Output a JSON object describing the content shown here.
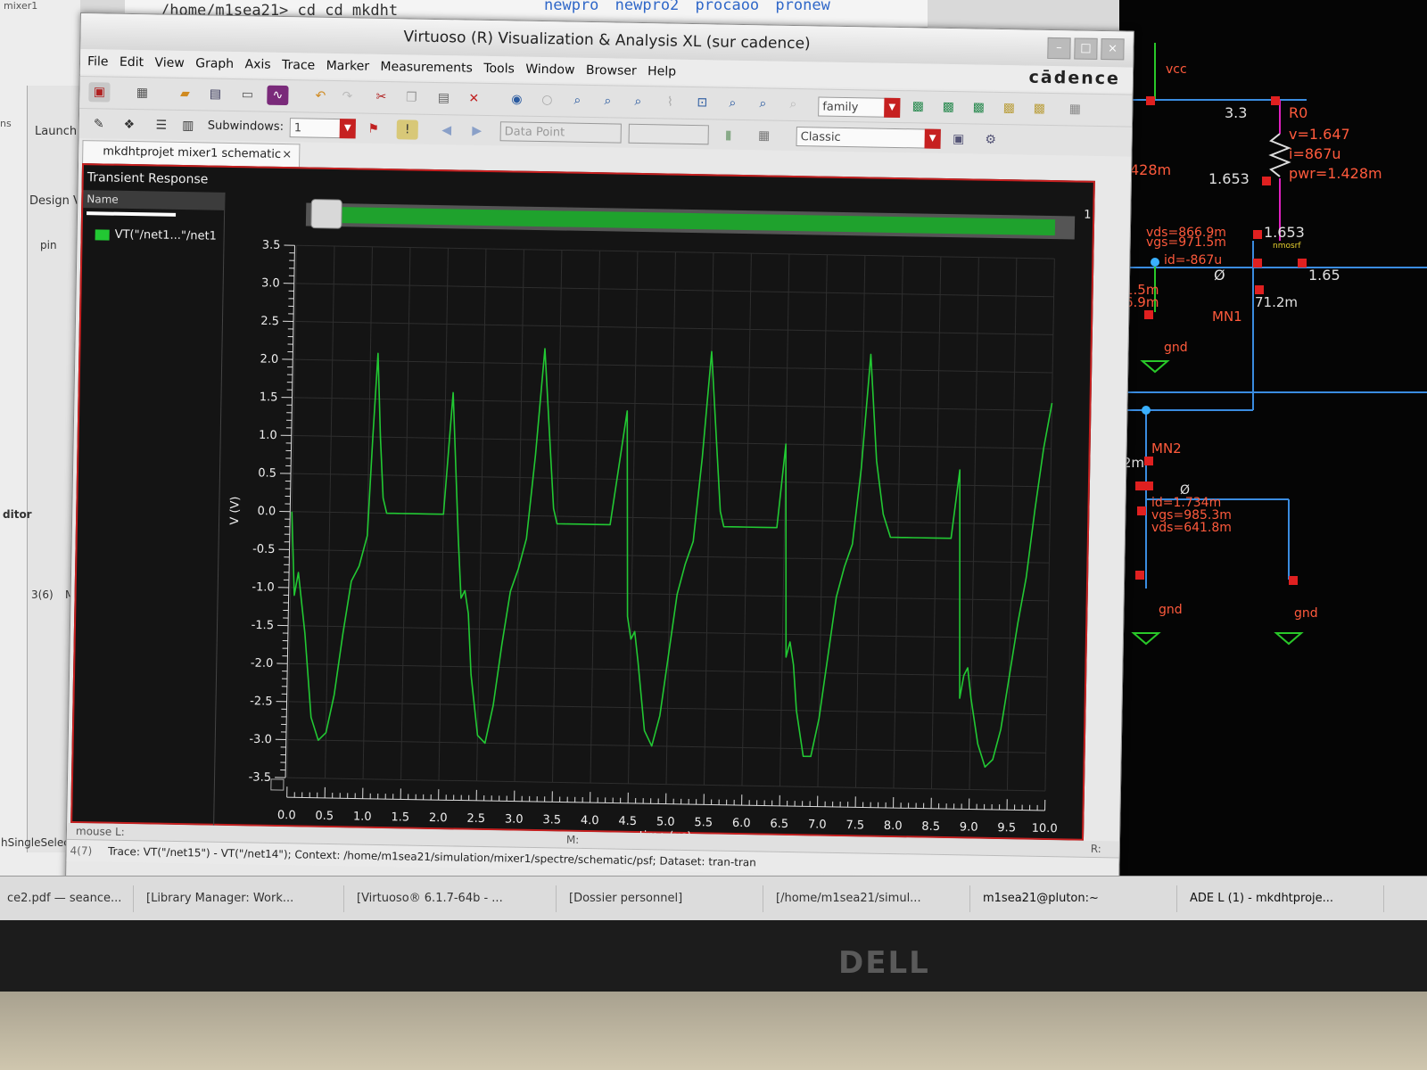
{
  "terminal": {
    "path": "/home/m1sea21> cd cd mkdht",
    "dirs": "newpro  newpro2  procaoo  pronew"
  },
  "left": {
    "mixer": "mixer1",
    "ns": "ns",
    "launch": "Launch",
    "design": "Design V",
    "pin": "pin",
    "ditor": "ditor",
    "count": "3(6)",
    "ma": "Ma",
    "single": "hSingleSelectP"
  },
  "window": {
    "title": "Virtuoso (R) Visualization & Analysis XL (sur cadence)",
    "logo": "cādence",
    "menu": [
      "File",
      "Edit",
      "View",
      "Graph",
      "Axis",
      "Trace",
      "Marker",
      "Measurements",
      "Tools",
      "Window",
      "Browser",
      "Help"
    ],
    "toolbar": {
      "family": "family",
      "subwindows_label": "Subwindows:",
      "subwindows_value": "1",
      "data_point": "Data Point",
      "classic": "Classic"
    },
    "tab": "mkdhtprojet mixer1 schematic",
    "tab_close": "×"
  },
  "graph": {
    "title": "Transient Response",
    "legend_header": "Name",
    "legend_entry": "VT(\"/net1...\"/net1",
    "subwindow_no": "1"
  },
  "chart_data": {
    "type": "line",
    "xlabel": "time (us)",
    "ylabel": "V (V)",
    "xlim": [
      0,
      10
    ],
    "ylim": [
      -3.5,
      3.5
    ],
    "xticks": [
      "0.0",
      "0.5",
      "1.0",
      "1.5",
      "2.0",
      "2.5",
      "3.0",
      "3.5",
      "4.0",
      "4.5",
      "5.0",
      "5.5",
      "6.0",
      "6.5",
      "7.0",
      "7.5",
      "8.0",
      "8.5",
      "9.0",
      "9.5",
      "10.0"
    ],
    "yticks": [
      "3.5",
      "3.0",
      "2.5",
      "2.0",
      "1.5",
      "1.0",
      "0.5",
      "0.0",
      "-0.5",
      "-1.0",
      "-1.5",
      "-2.0",
      "-2.5",
      "-3.0",
      "-3.5"
    ],
    "grid": true,
    "color": "#22c833",
    "series": [
      {
        "x": [
          0.0,
          0.05,
          0.1,
          0.2,
          0.3,
          0.4,
          0.5,
          0.6,
          0.7,
          0.8,
          0.9,
          1.0,
          1.05,
          1.1,
          1.15,
          1.2,
          1.25,
          1.3,
          1.35,
          1.4,
          1.45,
          1.5,
          1.6,
          1.8,
          2.0,
          2.1,
          2.2,
          2.25,
          2.3,
          2.35,
          2.4,
          2.5,
          2.6,
          2.7,
          2.8,
          2.9,
          3.0,
          3.1,
          3.2,
          3.3,
          3.4,
          3.45,
          3.5,
          3.55,
          3.6,
          3.7,
          3.8,
          4.0,
          4.2,
          4.4,
          4.45,
          4.5,
          4.55,
          4.6,
          4.7,
          4.8,
          4.9,
          5.0,
          5.1,
          5.2,
          5.3,
          5.4,
          5.5,
          5.6,
          5.65,
          5.7,
          5.75,
          5.8,
          5.9,
          6.0,
          6.2,
          6.4,
          6.5,
          6.55,
          6.6,
          6.65,
          6.7,
          6.8,
          6.9,
          7.0,
          7.1,
          7.2,
          7.3,
          7.4,
          7.5,
          7.6,
          7.7,
          7.8,
          7.9,
          7.95,
          8.0,
          8.05,
          8.1,
          8.2,
          8.3,
          8.5,
          8.7,
          8.8,
          8.85,
          8.9,
          8.95,
          9.0,
          9.1,
          9.2,
          9.3,
          9.4,
          9.5,
          9.6,
          9.7,
          9.8,
          9.9,
          10.0
        ],
        "y": [
          0.0,
          -1.1,
          -0.8,
          -1.6,
          -2.7,
          -3.0,
          -2.9,
          -2.4,
          -1.6,
          -0.9,
          -0.7,
          -0.3,
          1.0,
          2.1,
          1.0,
          0.2,
          0.0,
          0.0,
          0.0,
          0.0,
          0.0,
          0.0,
          0.0,
          0.0,
          0.0,
          1.6,
          -0.3,
          -1.1,
          -1.0,
          -1.3,
          -2.1,
          -2.9,
          -3.0,
          -2.5,
          -1.7,
          -1.0,
          -0.7,
          -0.3,
          0.8,
          2.2,
          0.8,
          0.1,
          -0.1,
          -0.1,
          -0.1,
          -0.1,
          -0.1,
          -0.1,
          -0.1,
          1.4,
          -1.3,
          -1.6,
          -1.5,
          -1.9,
          -2.8,
          -3.0,
          -2.6,
          -1.8,
          -1.0,
          -0.6,
          -0.3,
          0.8,
          2.2,
          0.8,
          0.1,
          -0.1,
          -0.1,
          -0.1,
          -0.1,
          -0.1,
          -0.1,
          -0.1,
          1.0,
          -1.8,
          -1.6,
          -1.9,
          -2.5,
          -3.1,
          -3.1,
          -2.6,
          -1.8,
          -1.0,
          -0.6,
          -0.3,
          0.7,
          2.2,
          0.8,
          0.1,
          -0.2,
          -0.2,
          -0.2,
          -0.2,
          -0.2,
          -0.2,
          -0.2,
          -0.2,
          -0.2,
          0.7,
          -2.3,
          -2.0,
          -1.9,
          -2.3,
          -2.9,
          -3.2,
          -3.1,
          -2.7,
          -2.0,
          -1.3,
          -0.7,
          0.2,
          1.0,
          1.6
        ]
      }
    ]
  },
  "status": {
    "mouse": "mouse L:",
    "middle": "M:",
    "right": "R:",
    "count": "4(7)",
    "trace": "Trace: VT(\"/net15\") - VT(\"/net14\"); Context: /home/m1sea21/simulation/mixer1/spectre/schematic/psf; Dataset: tran-tran"
  },
  "taskbar": [
    "ce2.pdf — seance...",
    "[Library Manager: Work...",
    "[Virtuoso® 6.1.7-64b - ...",
    "[Dossier personnel]",
    "[/home/m1sea21/simul...",
    "m1sea21@pluton:~",
    "ADE L (1) - mkdhtproje..."
  ],
  "schematic": {
    "labels": [
      {
        "t": "vcc",
        "c": "#ff5a3c"
      },
      {
        "t": "3.3",
        "c": "#e0e0e0"
      },
      {
        "t": "R0",
        "c": "#ff5a3c"
      },
      {
        "t": "v=1.647",
        "c": "#ff5a3c"
      },
      {
        "t": "i=867u",
        "c": "#ff5a3c"
      },
      {
        "t": "pwr=1.428m",
        "c": "#ff5a3c"
      },
      {
        "t": "428m",
        "c": "#ff5a3c"
      },
      {
        "t": "1.653",
        "c": "#e0e0e0"
      },
      {
        "t": "vds=866.9m",
        "c": "#ff5a3c"
      },
      {
        "t": "vgs=971.5m",
        "c": "#ff5a3c"
      },
      {
        "t": "1.653",
        "c": "#e0e0e0"
      },
      {
        "t": "nmosrf",
        "c": "#e8d030"
      },
      {
        "t": "id=-867u",
        "c": "#ff5a3c"
      },
      {
        "t": "Ø",
        "c": "#e0e0e0"
      },
      {
        "t": "1.65",
        "c": "#e0e0e0"
      },
      {
        "t": "1.5m",
        "c": "#ff5a3c"
      },
      {
        "t": "6.9m",
        "c": "#ff5a3c"
      },
      {
        "t": "MN1",
        "c": "#ff5a3c"
      },
      {
        "t": "71.2m",
        "c": "#e0e0e0"
      },
      {
        "t": "gnd",
        "c": "#ff5a3c"
      },
      {
        "t": "MN2",
        "c": "#ff5a3c"
      },
      {
        "t": "71.2m",
        "c": "#e0e0e0"
      },
      {
        "t": "Ø",
        "c": "#e0e0e0"
      },
      {
        "t": "id=1.734m",
        "c": "#ff5a3c"
      },
      {
        "t": "nmosrf",
        "c": "#e8d030"
      },
      {
        "t": "vgs=985.3m",
        "c": "#ff5a3c"
      },
      {
        "t": "vds=641.8m",
        "c": "#ff5a3c"
      },
      {
        "t": "Ø",
        "c": "#e0e0e0"
      },
      {
        "t": "gnd",
        "c": "#ff5a3c"
      },
      {
        "t": "gnd",
        "c": "#ff5a3c"
      }
    ]
  },
  "monitor_brand": "DELL"
}
